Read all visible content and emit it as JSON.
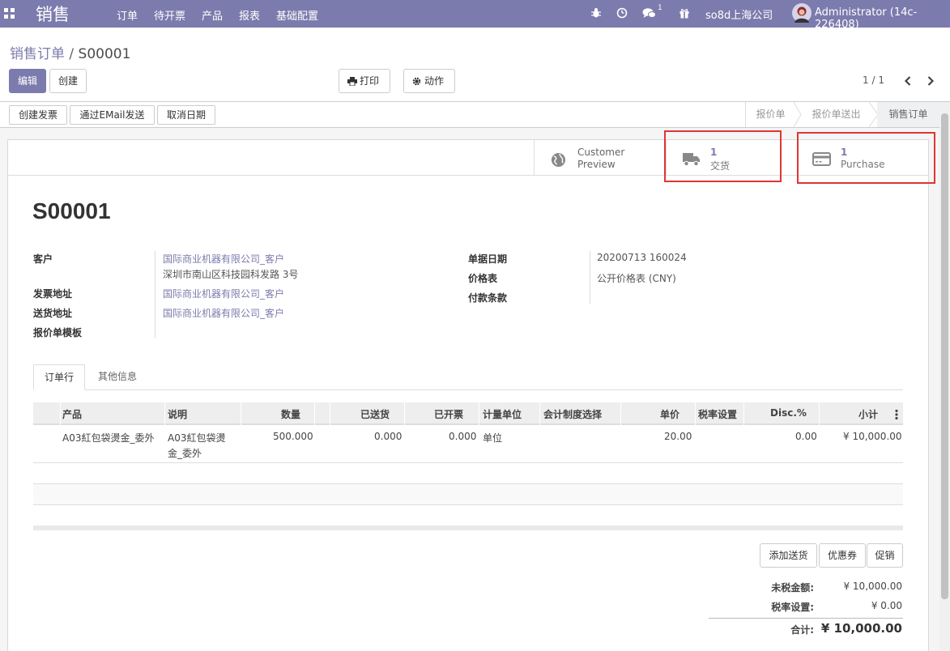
{
  "nav": {
    "app_title": "销售",
    "menus": [
      "订单",
      "待开票",
      "产品",
      "报表",
      "基础配置"
    ],
    "chat_count": "1",
    "company": "so8d上海公司",
    "user": "Administrator (14c-226408)"
  },
  "breadcrumb": {
    "parent": "销售订单",
    "separator": "/",
    "current": "S00001"
  },
  "toolbar": {
    "edit": "编辑",
    "create": "创建",
    "print": "打印",
    "action": "动作",
    "pager": "1 / 1"
  },
  "status_buttons": [
    "创建发票",
    "通过EMail发送",
    "取消日期"
  ],
  "stages": [
    "报价单",
    "报价单送出",
    "销售订单"
  ],
  "smart_buttons": {
    "preview": {
      "line1": "Customer",
      "line2": "Preview"
    },
    "delivery": {
      "count": "1",
      "label": "交货"
    },
    "purchase": {
      "count": "1",
      "label": "Purchase"
    }
  },
  "order": {
    "name": "S00001",
    "left_fields": [
      {
        "label": "客户",
        "value": "国际商业机器有限公司_客户",
        "value2": "深圳市南山区科技园科发路 3号"
      },
      {
        "label": "发票地址",
        "value": "国际商业机器有限公司_客户"
      },
      {
        "label": "送货地址",
        "value": "国际商业机器有限公司_客户"
      },
      {
        "label": "报价单模板",
        "value": ""
      }
    ],
    "right_fields": [
      {
        "label": "单据日期",
        "value": "20200713 160024"
      },
      {
        "label": "价格表",
        "value": "公开价格表 (CNY)"
      },
      {
        "label": "付款条款",
        "value": ""
      }
    ]
  },
  "tabs": [
    "订单行",
    "其他信息"
  ],
  "table": {
    "columns": [
      "产品",
      "说明",
      "数量",
      "已送货",
      "已开票",
      "计量单位",
      "会计制度选择",
      "单价",
      "税率设置",
      "Disc.%",
      "小计"
    ],
    "rows": [
      {
        "product": "A03紅包袋燙金_委外",
        "description_l1": "A03紅包袋燙",
        "description_l2": "金_委外",
        "qty": "500.000",
        "delivered": "0.000",
        "invoiced": "0.000",
        "uom": "单位",
        "price": "20.00",
        "disc": "0.00",
        "subtotal": "¥ 10,000.00"
      }
    ]
  },
  "line_buttons": [
    "添加送货",
    "优惠券",
    "促销"
  ],
  "totals": {
    "untaxed_label": "未税金额:",
    "untaxed": "¥ 10,000.00",
    "tax_label": "税率设置:",
    "tax": "¥ 0.00",
    "total_label": "合计:",
    "total": "¥ 10,000.00"
  }
}
